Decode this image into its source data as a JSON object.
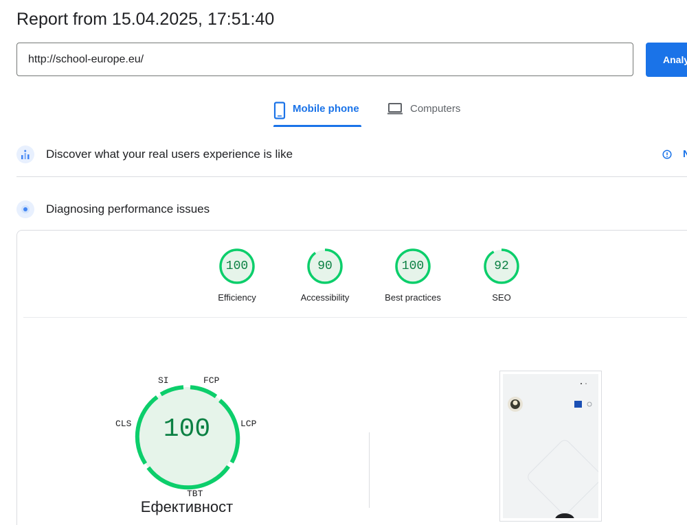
{
  "report": {
    "title": "Report from 15.04.2025, 17:51:40"
  },
  "search": {
    "url_value": "http://school-europe.eu/",
    "analyze_label": "Analy"
  },
  "tabs": [
    {
      "label": "Mobile phone",
      "active": true
    },
    {
      "label": "Computers",
      "active": false
    }
  ],
  "sections": {
    "real_users": {
      "title": "Discover what your real users experience is like",
      "link_label": "N"
    },
    "diagnosing": {
      "title": "Diagnosing performance issues"
    }
  },
  "categories": [
    {
      "score": "100",
      "label": "Efficiency",
      "fraction": 1.0
    },
    {
      "score": "90",
      "label": "Accessibility",
      "fraction": 0.9
    },
    {
      "score": "100",
      "label": "Best practices",
      "fraction": 1.0
    },
    {
      "score": "92",
      "label": "SEO",
      "fraction": 0.92
    }
  ],
  "performance": {
    "score": "100",
    "label": "Ефективност",
    "metrics": {
      "si": "SI",
      "fcp": "FCP",
      "lcp": "LCP",
      "tbt": "TBT",
      "cls": "CLS"
    }
  },
  "colors": {
    "accent": "#1a73e8",
    "pass": "#0cce6b",
    "pass_text": "#0b8043",
    "pass_fill": "#e6f4ea"
  }
}
